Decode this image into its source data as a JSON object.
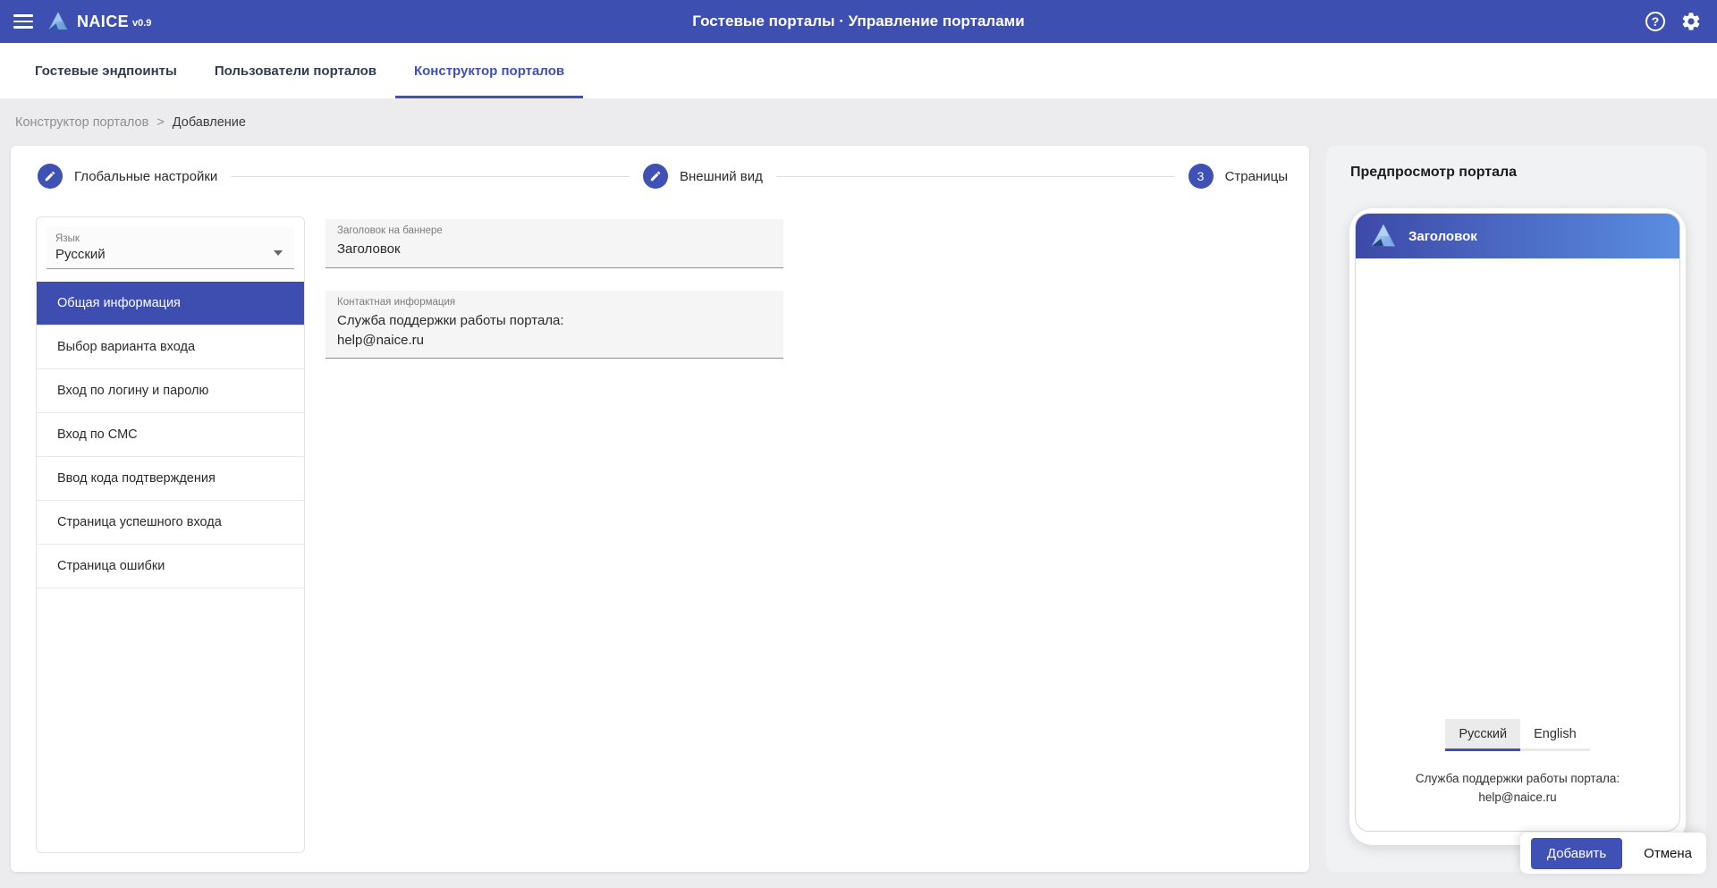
{
  "header": {
    "app_name": "NAICE",
    "app_version": "v0.9",
    "title": "Гостевые порталы · Управление порталами"
  },
  "tabs": [
    {
      "label": "Гостевые эндпоинты",
      "active": false
    },
    {
      "label": "Пользователи порталов",
      "active": false
    },
    {
      "label": "Конструктор порталов",
      "active": true
    }
  ],
  "breadcrumb": {
    "parent": "Конструктор порталов",
    "separator": ">",
    "current": "Добавление"
  },
  "stepper": {
    "steps": [
      {
        "label": "Глобальные настройки",
        "icon": "edit"
      },
      {
        "label": "Внешний вид",
        "icon": "edit"
      },
      {
        "label": "Страницы",
        "icon": "number",
        "number": "3"
      }
    ]
  },
  "editor": {
    "language": {
      "label": "Язык",
      "value": "Русский"
    },
    "sections": [
      {
        "label": "Общая информация",
        "selected": true
      },
      {
        "label": "Выбор варианта входа",
        "selected": false
      },
      {
        "label": "Вход по логину и паролю",
        "selected": false
      },
      {
        "label": "Вход по СМС",
        "selected": false
      },
      {
        "label": "Ввод кода подтверждения",
        "selected": false
      },
      {
        "label": "Страница успешного входа",
        "selected": false
      },
      {
        "label": "Страница ошибки",
        "selected": false
      }
    ]
  },
  "form": {
    "banner_title": {
      "label": "Заголовок на баннере",
      "value": "Заголовок"
    },
    "contact_info": {
      "label": "Контактная информация",
      "value": "Служба поддержки работы портала:\nhelp@naice.ru"
    }
  },
  "preview": {
    "panel_title": "Предпросмотр портала",
    "banner_title": "Заголовок",
    "language_tabs": [
      {
        "label": "Русский",
        "active": true
      },
      {
        "label": "English",
        "active": false
      }
    ],
    "support_text": "Служба поддержки работы портала:\nhelp@naice.ru"
  },
  "actions": {
    "add_label": "Добавить",
    "cancel_label": "Отмена"
  },
  "colors": {
    "accent": "#3f51b5",
    "header_bg": "#3e4fb2",
    "banner_start": "#3e49a8",
    "banner_end": "#5a8de0"
  }
}
